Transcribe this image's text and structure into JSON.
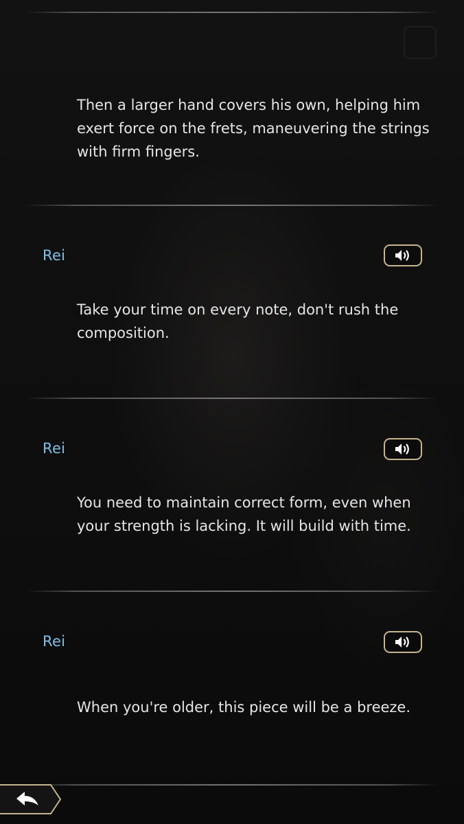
{
  "log": {
    "entries": [
      {
        "speaker": "",
        "text": "Then a larger hand covers his own, helping him exert force on the frets, maneuvering the strings with firm fingers.",
        "has_voice": false
      },
      {
        "speaker": "Rei",
        "text": "Take your time on every note, don't rush the composition.",
        "has_voice": true
      },
      {
        "speaker": "Rei",
        "text": "You need to maintain correct form, even when your strength is lacking. It will build with time.",
        "has_voice": true
      },
      {
        "speaker": "Rei",
        "text": "When you're older, this piece will be a breeze.",
        "has_voice": true
      }
    ]
  },
  "icons": {
    "voice": "speaker-icon",
    "back": "back-arrow-icon"
  },
  "colors": {
    "speaker_name": "#7ec0e6",
    "voice_button_border": "#c8b58e",
    "dialogue_text": "#e6e6e6"
  }
}
